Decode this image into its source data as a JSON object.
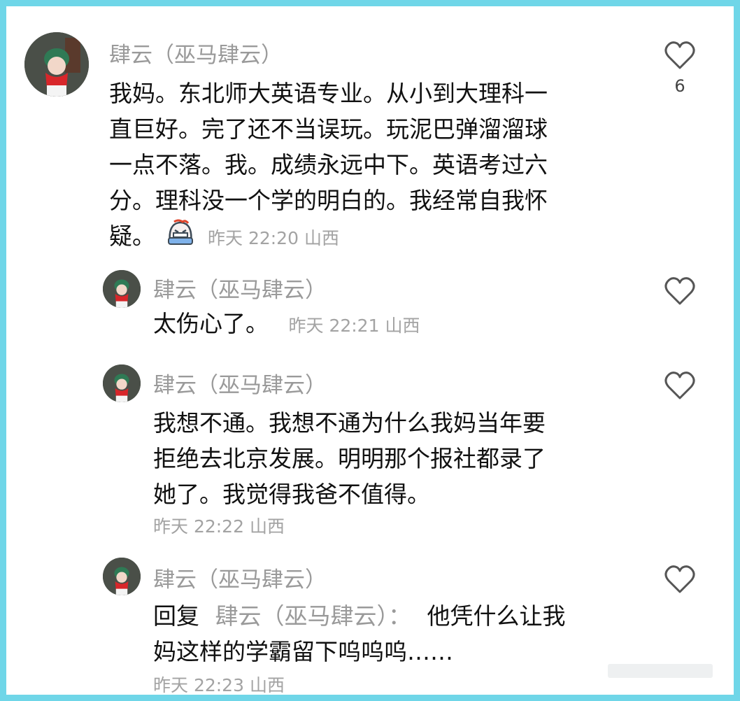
{
  "comments": [
    {
      "author": "肆云（巫马肆云）",
      "text_lines": [
        "我妈。东北师大英语专业。从小到大理科一",
        "直巨好。完了还不当误玩。玩泥巴弹溜溜球",
        "一点不落。我。成绩永远中下。英语考过六",
        "分。理科没一个学的明白的。我经常自我怀",
        "疑。"
      ],
      "emoji": "crying-face-emoji",
      "meta": "昨天 22:20 山西",
      "likes": "6"
    },
    {
      "author": "肆云（巫马肆云）",
      "text": "太伤心了。",
      "meta": "昨天 22:21 山西"
    },
    {
      "author": "肆云（巫马肆云）",
      "text_lines": [
        "我想不通。我想不通为什么我妈当年要",
        "拒绝去北京发展。明明那个报社都录了",
        "她了。我觉得我爸不值得。"
      ],
      "meta": "昨天 22:22 山西"
    },
    {
      "author": "肆云（巫马肆云）",
      "reply_prefix": "回复",
      "reply_target": "肆云（巫马肆云）：",
      "text_first": "他凭什么让我",
      "text_second": "妈这样的学霸留下呜呜呜……",
      "meta": "昨天 22:23 山西"
    }
  ],
  "colors": {
    "border": "#6fd6e8",
    "meta": "#a3a3a3",
    "author": "#9a9a9a",
    "text": "#111111"
  },
  "icons": {
    "like": "heart-outline-icon"
  }
}
